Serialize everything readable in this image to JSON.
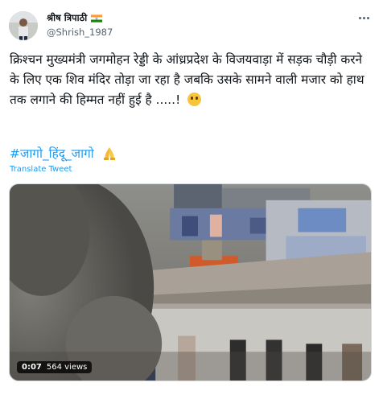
{
  "author": {
    "display_name": "श्रीष त्रिपाठी",
    "handle": "@Shrish_1987",
    "flag_icon": "india-flag-icon"
  },
  "tweet": {
    "text": "क्रिश्चन मुख्यमंत्री जगमोहन रेड्डी के आंध्रप्रदेश के विजयवाड़ा में सड़क चौड़ी करने के लिए एक शिव मंदिर तोड़ा जा रहा है जबकि उसके सामने वाली मजार को हाथ तक लगाने की हिम्मत नहीं हुई है .....!",
    "emoji": "thinking-face-icon",
    "hashtag": "#जागो_हिंदू_जागो",
    "hashtag_emoji": "folded-hands-icon",
    "translate_label": "Translate Tweet"
  },
  "video": {
    "duration": "0:07",
    "views": "564 views"
  },
  "colors": {
    "link": "#1d9bf0",
    "text": "#0f1419",
    "secondary": "#536471"
  }
}
